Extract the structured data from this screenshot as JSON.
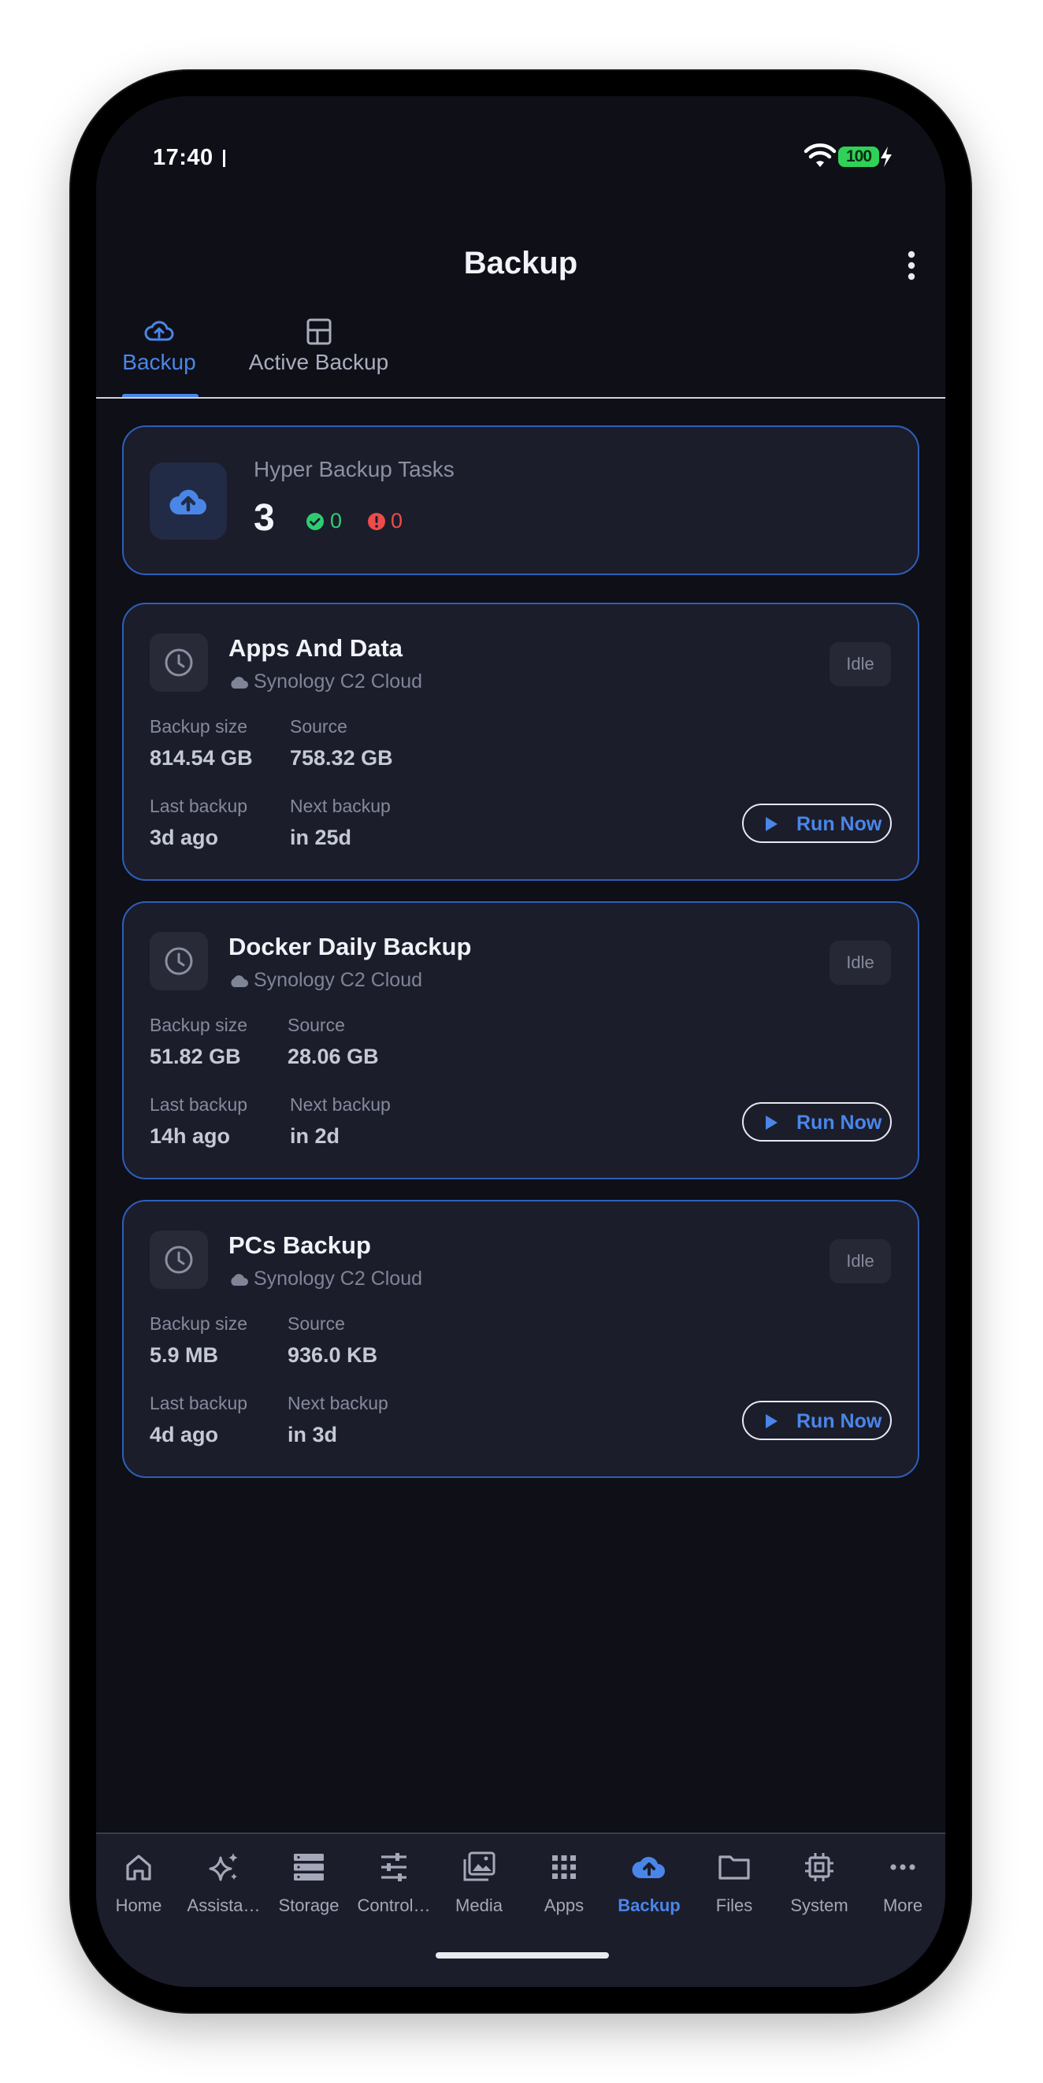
{
  "status_bar": {
    "time": "17:40",
    "battery": "100"
  },
  "header": {
    "title": "Backup"
  },
  "tabs": [
    {
      "label": "Backup",
      "icon": "cloud-upload-outline-icon",
      "active": true
    },
    {
      "label": "Active Backup",
      "icon": "layout-panels-icon",
      "active": false
    }
  ],
  "summary": {
    "title": "Hyper Backup Tasks",
    "count": "3",
    "ok_count": "0",
    "error_count": "0",
    "ok_color": "#2ecc71",
    "error_color": "#ef4b4b"
  },
  "labels": {
    "backup_size": "Backup size",
    "source": "Source",
    "last_backup": "Last backup",
    "next_backup": "Next backup",
    "run_now": "Run Now"
  },
  "tasks": [
    {
      "name": "Apps And Data",
      "destination": "Synology C2 Cloud",
      "status": "Idle",
      "backup_size": "814.54 GB",
      "source": "758.32 GB",
      "last_backup": "3d ago",
      "next_backup": "in 25d"
    },
    {
      "name": "Docker Daily Backup",
      "destination": "Synology C2 Cloud",
      "status": "Idle",
      "backup_size": "51.82 GB",
      "source": "28.06 GB",
      "last_backup": "14h ago",
      "next_backup": "in 2d"
    },
    {
      "name": "PCs Backup",
      "destination": "Synology C2 Cloud",
      "status": "Idle",
      "backup_size": "5.9 MB",
      "source": "936.0 KB",
      "last_backup": "4d ago",
      "next_backup": "in 3d"
    }
  ],
  "nav": [
    {
      "label": "Home",
      "icon": "home-icon"
    },
    {
      "label": "Assista…",
      "icon": "sparkles-icon"
    },
    {
      "label": "Storage",
      "icon": "storage-icon"
    },
    {
      "label": "Control…",
      "icon": "sliders-icon"
    },
    {
      "label": "Media",
      "icon": "media-icon"
    },
    {
      "label": "Apps",
      "icon": "apps-grid-icon"
    },
    {
      "label": "Backup",
      "icon": "cloud-upload-icon",
      "active": true
    },
    {
      "label": "Files",
      "icon": "folder-icon"
    },
    {
      "label": "System",
      "icon": "chip-icon"
    },
    {
      "label": "More",
      "icon": "more-horizontal-icon"
    }
  ],
  "colors": {
    "accent": "#4a86e8",
    "card_border": "#2f5eb8",
    "background": "#0e0f17",
    "card": "#1b1d2b"
  }
}
